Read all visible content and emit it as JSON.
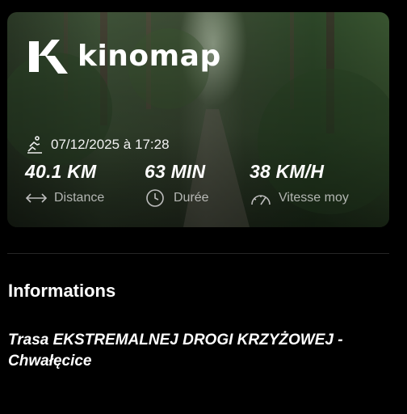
{
  "brand": {
    "name": "kinomap"
  },
  "activity": {
    "datetime": "07/12/2025 à 17:28",
    "stats": [
      {
        "value": "40.1 KM",
        "label": "Distance",
        "icon": "distance-arrows-icon"
      },
      {
        "value": "63 MIN",
        "label": "Durée",
        "icon": "clock-icon"
      },
      {
        "value": "38 KM/H",
        "label": "Vitesse moy",
        "icon": "speedometer-icon"
      }
    ]
  },
  "info": {
    "heading": "Informations",
    "route_title": "Trasa EKSTREMALNEJ DROGI KRZYŻOWEJ - Chwałęcice"
  },
  "colors": {
    "background": "#000000",
    "text": "#ffffff",
    "muted": "#bdbdbd",
    "card_tint": "#3f5236"
  }
}
